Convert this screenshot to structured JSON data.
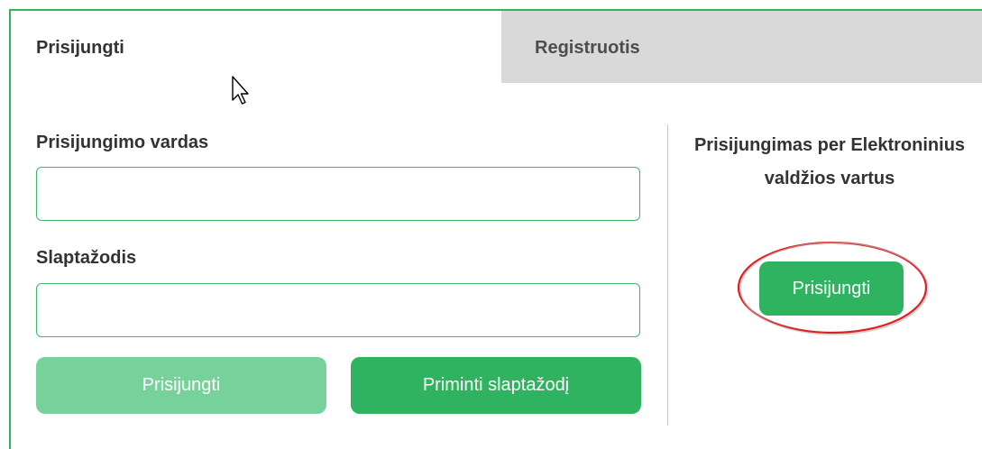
{
  "tabs": {
    "login": "Prisijungti",
    "register": "Registruotis"
  },
  "form": {
    "username_label": "Prisijungimo vardas",
    "username_value": "",
    "password_label": "Slaptažodis",
    "password_value": "",
    "login_button": "Prisijungti",
    "remind_button": "Priminti slaptažodį"
  },
  "evartai": {
    "title": "Prisijungimas per Elektroninius valdžios vartus",
    "button": "Prisijungti"
  },
  "colors": {
    "accent": "#2fb360",
    "accent_disabled": "#76d19b",
    "tab_inactive": "#d9d9d9",
    "highlight": "#e02020"
  },
  "icons": {
    "cursor": "arrow-cursor-icon"
  }
}
